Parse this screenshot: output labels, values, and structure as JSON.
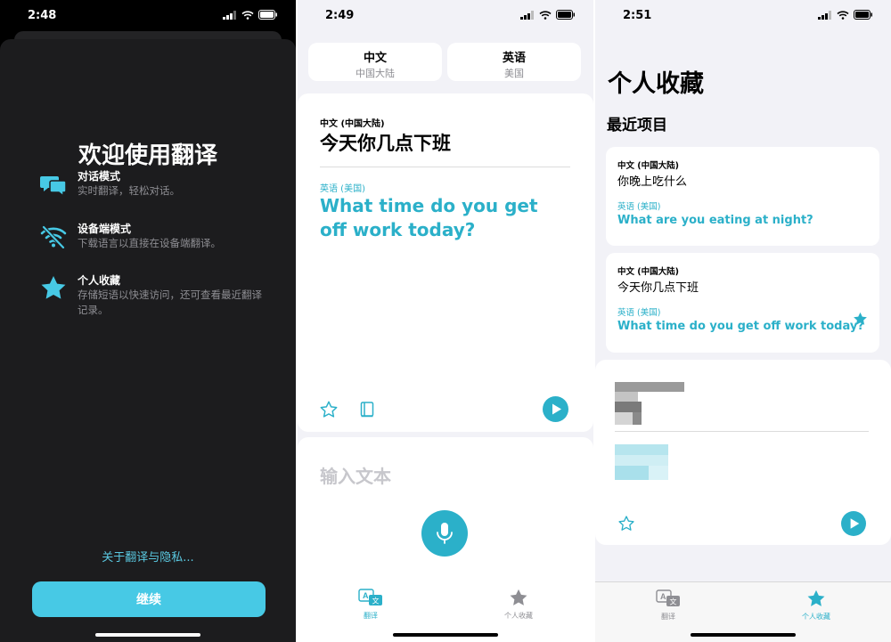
{
  "screen1": {
    "time": "2:48",
    "title": "欢迎使用翻译",
    "features": [
      {
        "title": "对话模式",
        "desc": "实时翻译，轻松对话。",
        "icon": "speech-bubbles-icon"
      },
      {
        "title": "设备端模式",
        "desc": "下载语言以直接在设备端翻译。",
        "icon": "wifi-off-icon"
      },
      {
        "title": "个人收藏",
        "desc": "存储短语以快速访问，还可查看最近翻译记录。",
        "icon": "star-icon"
      }
    ],
    "about_link": "关于翻译与隐私...",
    "continue_label": "继续",
    "accent": "#47c9e5"
  },
  "screen2": {
    "time": "2:49",
    "source_lang": {
      "name": "中文",
      "region": "中国大陆"
    },
    "target_lang": {
      "name": "英语",
      "region": "美国"
    },
    "source_label": "中文 (中国大陆)",
    "source_text": "今天你几点下班",
    "target_label": "英语 (美国)",
    "target_text": "What time do you get off work today?",
    "input_placeholder": "输入文本",
    "tabs": [
      {
        "label": "翻译",
        "icon": "translate-icon",
        "active": true
      },
      {
        "label": "个人收藏",
        "icon": "star-icon",
        "active": false
      }
    ],
    "accent": "#2bb0c9"
  },
  "screen3": {
    "time": "2:51",
    "title": "个人收藏",
    "section_title": "最近项目",
    "items": [
      {
        "source_label": "中文 (中国大陆)",
        "source_text": "你晚上吃什么",
        "target_label": "英语 (美国)",
        "target_text": "What are you eating at night?",
        "starred": false
      },
      {
        "source_label": "中文 (中国大陆)",
        "source_text": "今天你几点下班",
        "target_label": "英语 (美国)",
        "target_text": "What time do you get off work today?",
        "starred": true
      }
    ],
    "tabs": [
      {
        "label": "翻译",
        "icon": "translate-icon",
        "active": false
      },
      {
        "label": "个人收藏",
        "icon": "star-icon",
        "active": true
      }
    ]
  }
}
